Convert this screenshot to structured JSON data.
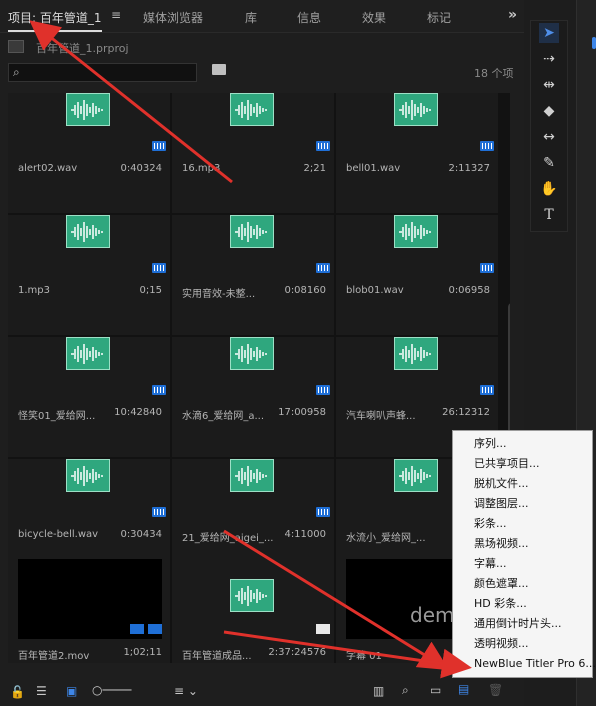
{
  "tabs": [
    {
      "label": "项目: 百年管道_1"
    },
    {
      "label": "媒体浏览器"
    },
    {
      "label": "库"
    },
    {
      "label": "信息"
    },
    {
      "label": "效果"
    },
    {
      "label": "标记"
    }
  ],
  "project": {
    "file": "百年管道_1.prproj",
    "item_count": "18 个项"
  },
  "items": [
    {
      "name": "alert02.wav",
      "duration": "0:40324"
    },
    {
      "name": "16.mp3",
      "duration": "2;21"
    },
    {
      "name": "bell01.wav",
      "duration": "2:11327"
    },
    {
      "name": "1.mp3",
      "duration": "0;15"
    },
    {
      "name": "实用音效-未整...",
      "duration": "0:08160"
    },
    {
      "name": "blob01.wav",
      "duration": "0:06958"
    },
    {
      "name": "怪笑01_爱给网...",
      "duration": "10:42840"
    },
    {
      "name": "水滴6_爱给网_a...",
      "duration": "17:00958"
    },
    {
      "name": "汽车喇叭声蜂...",
      "duration": "26:12312"
    },
    {
      "name": "bicycle-bell.wav",
      "duration": "0:30434"
    },
    {
      "name": "21_爱给网_aigei_...",
      "duration": "4:11000"
    },
    {
      "name": "水流小_爱给网_...",
      "duration": ""
    },
    {
      "name": "百年管道2.mov",
      "duration": "1;02;11"
    },
    {
      "name": "百年管道成品...",
      "duration": "2:37:24576"
    },
    {
      "name": "字幕 01",
      "duration": ""
    }
  ],
  "dem_text": "dem",
  "menu": {
    "items": [
      "序列...",
      "已共享项目...",
      "脱机文件...",
      "调整图层...",
      "彩条...",
      "黑场视频...",
      "字幕...",
      "颜色遮罩...",
      "HD 彩条...",
      "通用倒计时片头...",
      "透明视频...",
      "NewBlue Titler Pro 6..."
    ]
  },
  "colors": {
    "accent": "#3e86e8",
    "annotation_arrow": "#e0312b",
    "audio_thumb": "#2fa77e"
  }
}
